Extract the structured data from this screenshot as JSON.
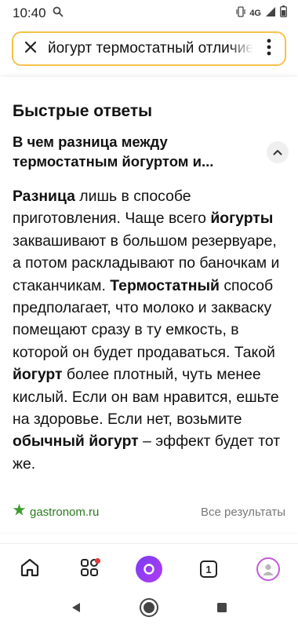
{
  "status": {
    "time": "10:40",
    "network": "4G"
  },
  "search": {
    "query": "йогурт термостатный отличие"
  },
  "quick_answers": {
    "title": "Быстрые ответы",
    "question": "В чем разница между термостатным йогуртом и...",
    "answer_segments": [
      {
        "text": "Разница",
        "bold": true
      },
      {
        "text": " лишь в способе приготовления. Чаще всего ",
        "bold": false
      },
      {
        "text": "йогурты",
        "bold": true
      },
      {
        "text": " заквашивают в большом резервуаре, а потом раскладывают по баночкам и стаканчикам. ",
        "bold": false
      },
      {
        "text": "Термостатный",
        "bold": true
      },
      {
        "text": " способ предполагает, что молоко и закваску помещают сразу в ту емкость, в которой он будет продаваться. Такой ",
        "bold": false
      },
      {
        "text": "йогурт",
        "bold": true
      },
      {
        "text": " более плотный, чуть менее кислый. Если он вам нравится, ешьте на здоровье. Если нет, возьмите ",
        "bold": false
      },
      {
        "text": "обычный йогурт",
        "bold": true
      },
      {
        "text": " – эффект будет тот же.",
        "bold": false
      }
    ],
    "source": "gastronom.ru",
    "all_results": "Все результаты"
  },
  "bottom_nav": {
    "tabs_count": "1"
  },
  "colors": {
    "search_border": "#f6c24a",
    "source_green": "#2b7a1f",
    "alice_purple": "#7a3cf4",
    "notification_red": "#e8353b"
  }
}
